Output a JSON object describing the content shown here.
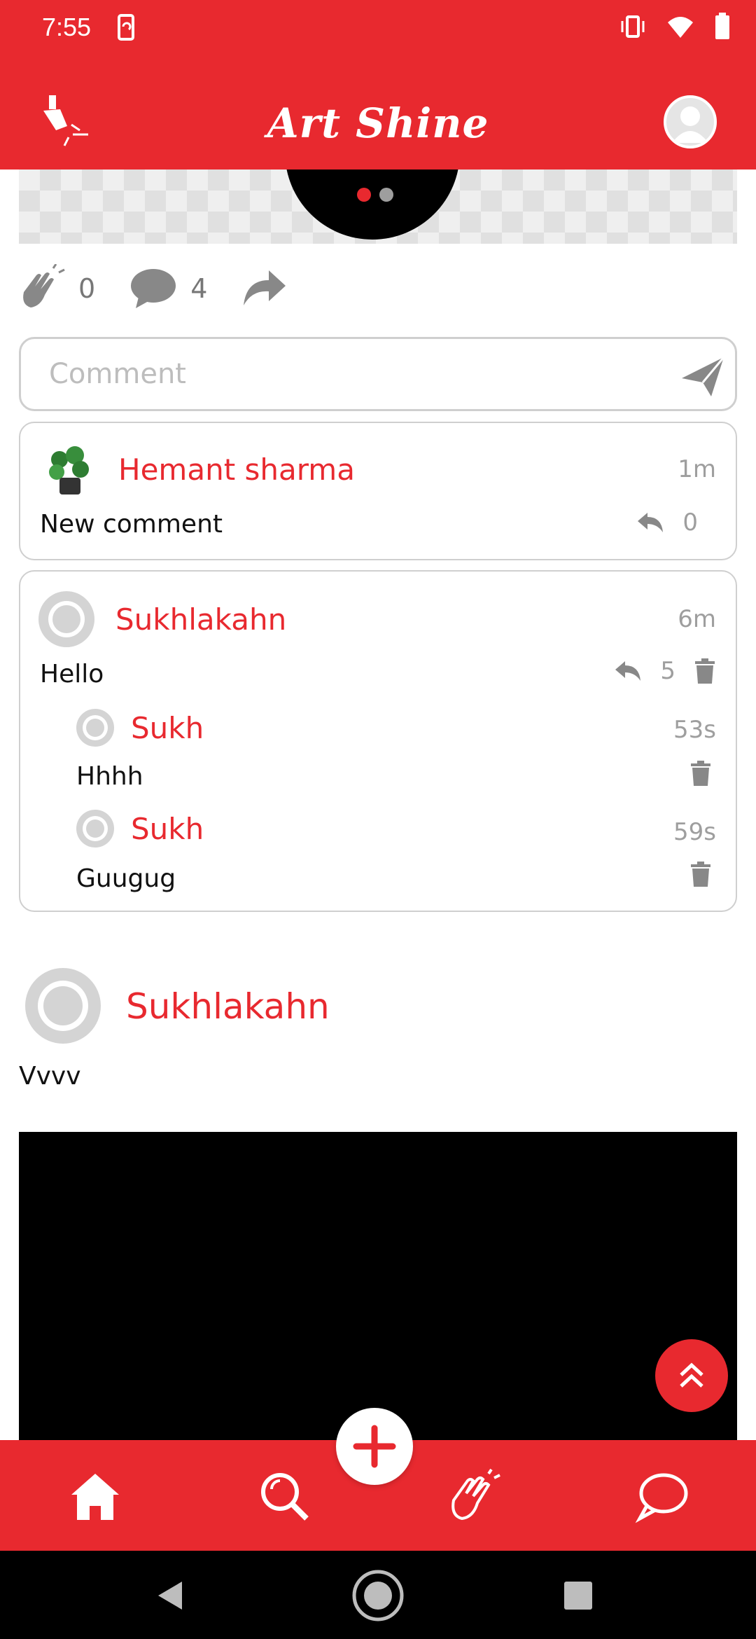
{
  "status": {
    "time": "7:55"
  },
  "app": {
    "title": "Art Shine"
  },
  "post": {
    "claps": "0",
    "comments_count": "4"
  },
  "comment_input": {
    "placeholder": "Comment"
  },
  "comments": [
    {
      "author": "Hemant sharma",
      "time": "1m",
      "text": "New comment",
      "replies": "0"
    },
    {
      "author": "Sukhlakahn",
      "time": "6m",
      "text": "Hello",
      "replies": "5",
      "sub": [
        {
          "author": "Sukh",
          "time": "53s",
          "text": "Hhhh"
        },
        {
          "author": "Sukh",
          "time": "59s",
          "text": "Guugug"
        }
      ]
    }
  ],
  "next_post": {
    "author": "Sukhlakahn",
    "text": "Vvvv"
  },
  "colors": {
    "accent": "#e8292f",
    "muted": "#9e9e9e"
  }
}
